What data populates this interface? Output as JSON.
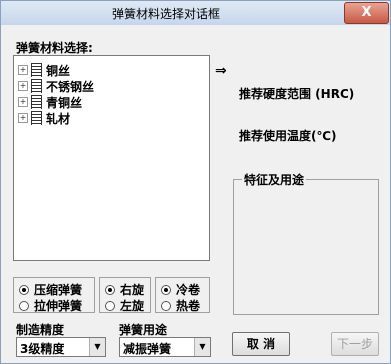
{
  "window": {
    "title": "弹簧材料选择对话框",
    "close_label": "X"
  },
  "material_label": "弹簧材料选择:",
  "tree": [
    {
      "label": "铜丝"
    },
    {
      "label": "不锈钢丝"
    },
    {
      "label": "青铜丝"
    },
    {
      "label": "轧材"
    }
  ],
  "arrow": "⇒",
  "hardness_label": "推荐硬度范围  (HRC)",
  "temperature_label": "推荐使用温度(℃)",
  "features": {
    "legend": "特征及用途"
  },
  "type_group": {
    "options": [
      "压缩弹簧",
      "拉伸弹簧"
    ],
    "selected": 0
  },
  "direction_group": {
    "options": [
      "右旋",
      "左旋"
    ],
    "selected": 0
  },
  "process_group": {
    "options": [
      "冷卷",
      "热卷"
    ],
    "selected": 0
  },
  "precision": {
    "label": "制造精度",
    "value": "3级精度"
  },
  "usage": {
    "label": "弹簧用途",
    "value": "减振弹簧"
  },
  "buttons": {
    "cancel": "取 消",
    "next": "下一步"
  }
}
